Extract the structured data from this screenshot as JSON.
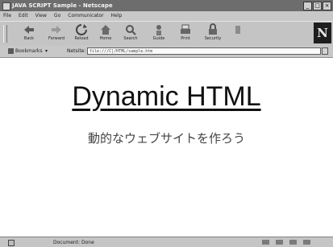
{
  "window": {
    "title": "JAVA SCRIPT Sample - Netscape",
    "controls": [
      "_",
      "□",
      "×"
    ]
  },
  "menu": [
    "File",
    "Edit",
    "View",
    "Go",
    "Communicator",
    "Help"
  ],
  "toolbar": {
    "buttons": [
      {
        "label": "Back",
        "icon": "back-arrow-icon"
      },
      {
        "label": "Forward",
        "icon": "forward-arrow-icon"
      },
      {
        "label": "Reload",
        "icon": "reload-icon"
      },
      {
        "label": "Home",
        "icon": "home-icon"
      },
      {
        "label": "Search",
        "icon": "search-icon"
      },
      {
        "label": "Guide",
        "icon": "guide-icon"
      },
      {
        "label": "Print",
        "icon": "print-icon"
      },
      {
        "label": "Security",
        "icon": "security-icon"
      },
      {
        "label": "",
        "icon": "stop-icon"
      }
    ],
    "brand": "N"
  },
  "location": {
    "bookmarks_label": "Bookmarks",
    "location_label": "Netsite:",
    "url": "file:///C|/HTML/sample.htm"
  },
  "page": {
    "heading": "Dynamic HTML",
    "subheading": "動的なウェブサイトを作ろう"
  },
  "status": {
    "text": "Document: Done"
  }
}
